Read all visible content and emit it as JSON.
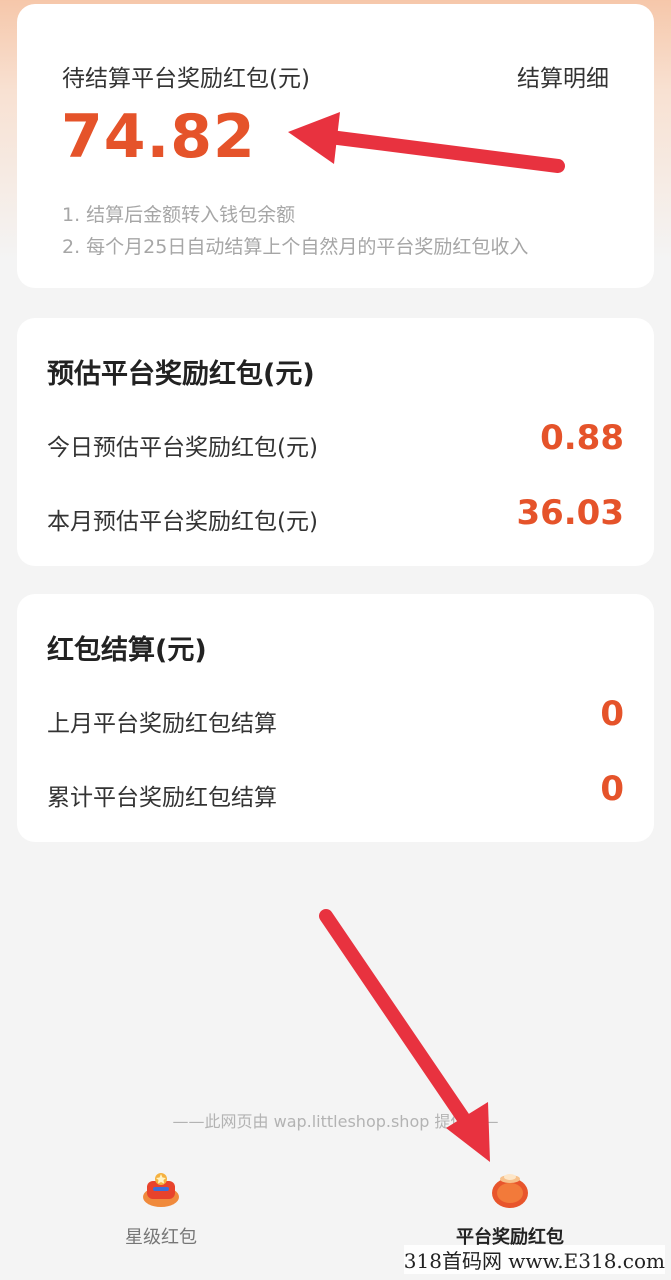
{
  "pending": {
    "title": "待结算平台奖励红包(元)",
    "detail_link": "结算明细",
    "amount": "74.82",
    "notes": [
      "1. 结算后金额转入钱包余额",
      "2. 每个月25日自动结算上个自然月的平台奖励红包收入"
    ]
  },
  "estimate": {
    "title": "预估平台奖励红包(元)",
    "rows": [
      {
        "label": "今日预估平台奖励红包(元)",
        "value": "0.88"
      },
      {
        "label": "本月预估平台奖励红包(元)",
        "value": "36.03"
      }
    ]
  },
  "settlement": {
    "title": "红包结算(元)",
    "rows": [
      {
        "label": "上月平台奖励红包结算",
        "value": "0"
      },
      {
        "label": "累计平台奖励红包结算",
        "value": "0"
      }
    ]
  },
  "footer": {
    "provider_note": "——此网页由 wap.littleshop.shop 提供——"
  },
  "tabs": [
    {
      "label": "星级红包",
      "icon": "star-redpacket-icon"
    },
    {
      "label": "平台奖励红包",
      "icon": "platform-redpacket-icon"
    }
  ],
  "watermark": "318首码网 www.E318.com",
  "colors": {
    "accent": "#e5532a",
    "annotation_arrow": "#e8323f"
  }
}
